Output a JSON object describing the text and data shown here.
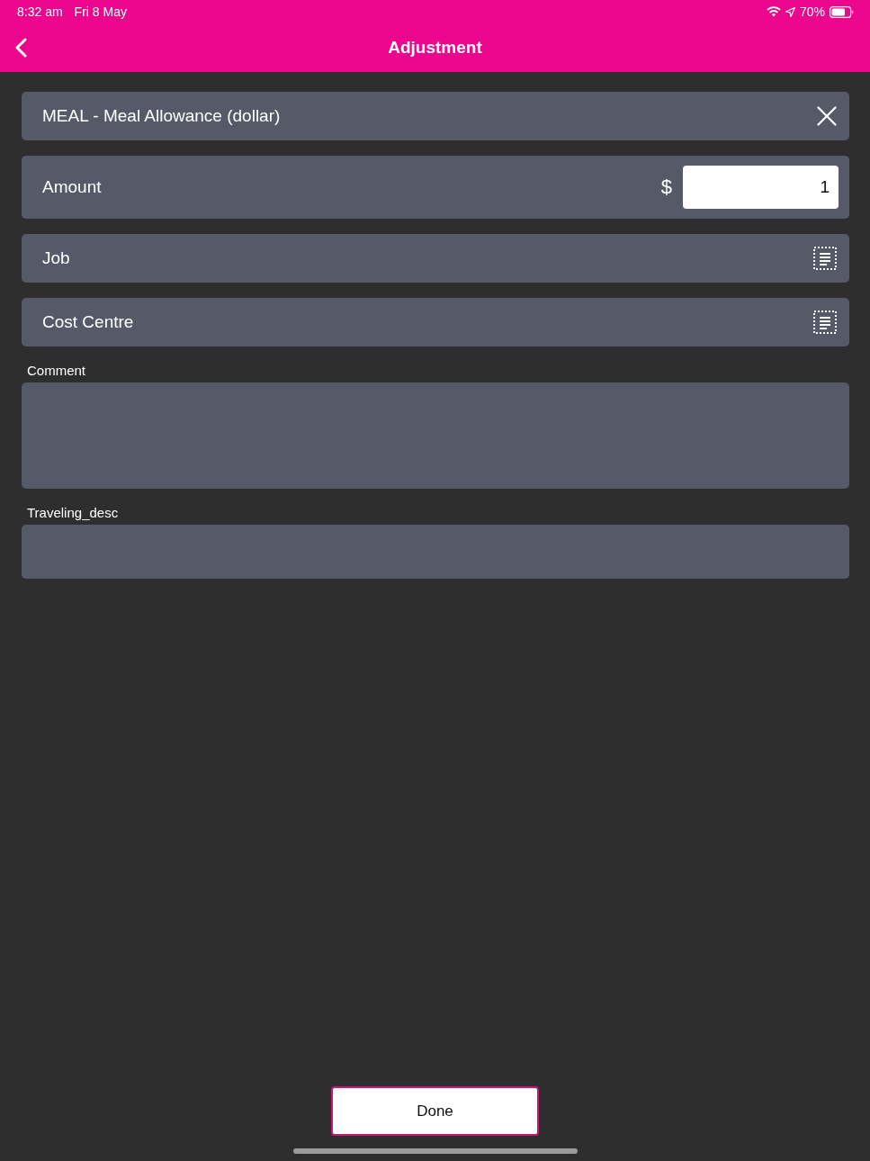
{
  "status_bar": {
    "time": "8:32 am",
    "date": "Fri 8 May",
    "battery_percent": "70%"
  },
  "nav_bar": {
    "title": "Adjustment"
  },
  "rows": [
    {
      "kind": "choice",
      "value": "MEAL - Meal Allowance (dollar)"
    },
    {
      "kind": "amount",
      "label": "Amount",
      "currency": "$",
      "value": "1"
    },
    {
      "kind": "picker",
      "label": "Job"
    },
    {
      "kind": "picker",
      "label": "Cost Centre"
    }
  ],
  "text_fields": [
    {
      "kind": "multiline",
      "label": "Comment"
    },
    {
      "kind": "single",
      "label": "Traveling_desc"
    }
  ],
  "done_button": {
    "label": "Done"
  }
}
